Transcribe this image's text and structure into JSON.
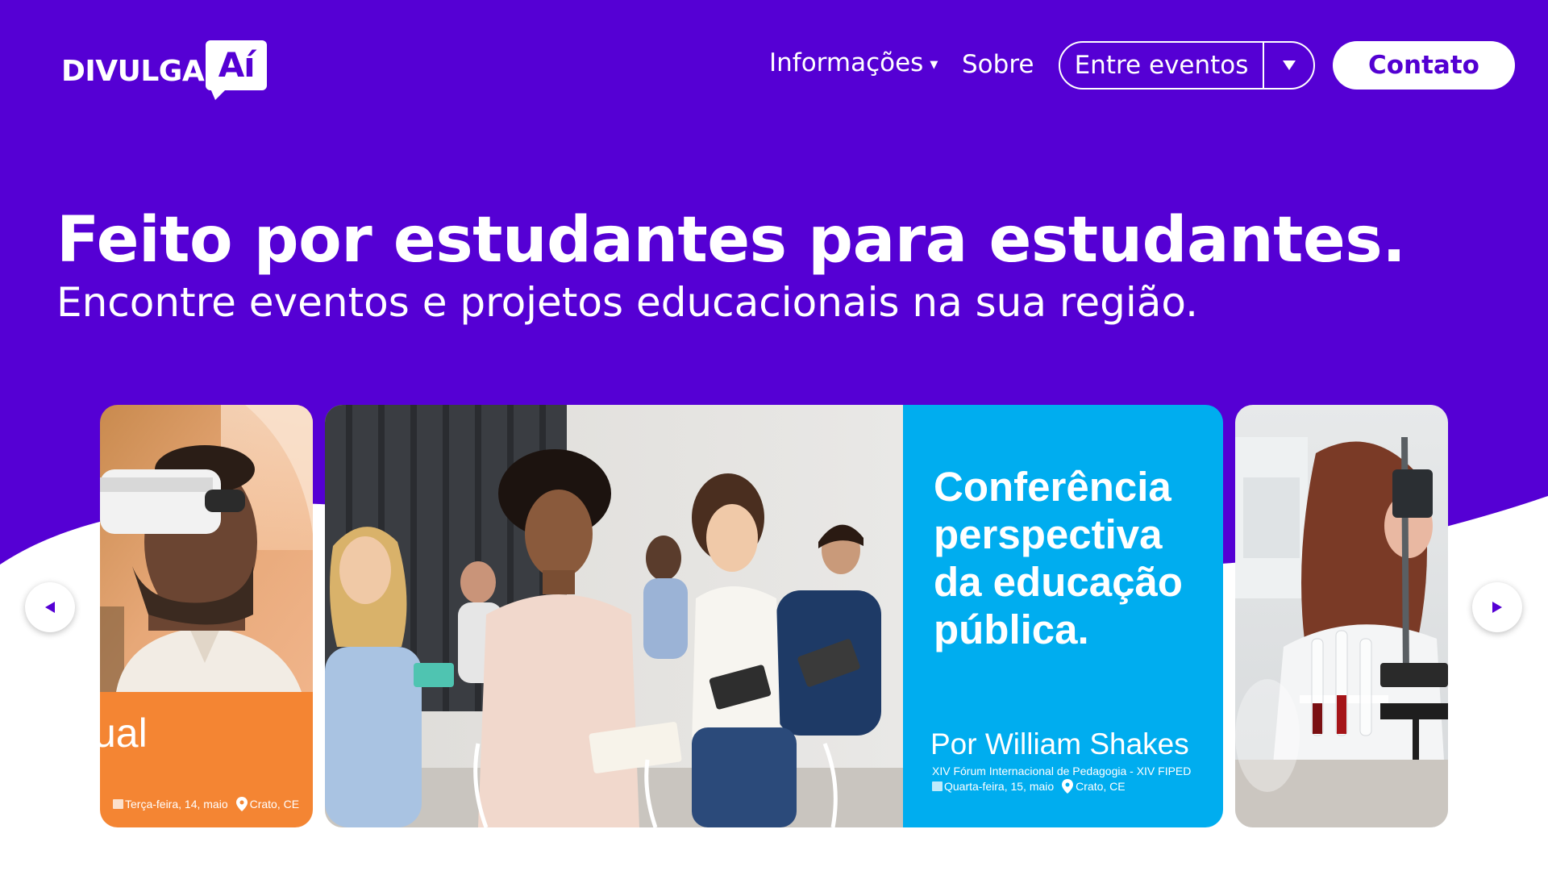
{
  "brand": {
    "name": "DIVULGA",
    "badge": "Aí",
    "primary_color": "#5500d4",
    "accent_color": "#ffffff"
  },
  "nav": {
    "info_label": "Informações",
    "about_label": "Sobre",
    "events_label": "Entre eventos",
    "contact_label": "Contato"
  },
  "hero": {
    "title": "Feito por estudantes para estudantes.",
    "subtitle": "Encontre eventos e projetos educacionais na sua região."
  },
  "carousel": {
    "prev_icon": "chevron-left-icon",
    "next_icon": "chevron-right-icon",
    "cards": [
      {
        "title_fragment": "ual",
        "date": "Terça-feira, 14, maio",
        "location": "Crato, CE",
        "panel_color": "#f48533",
        "image": "man-wearing-vr-headset"
      },
      {
        "title": "Conferência perspectiva da educação pública.",
        "author": "Por William Shakes",
        "event": "XIV Fórum Internacional de Pedagogia - XIV FIPED",
        "date": "Quarta-feira, 15, maio",
        "location": "Crato, CE",
        "panel_color": "#00adef",
        "image": "students-in-conference-audience"
      },
      {
        "image": "woman-at-microscope-in-lab"
      }
    ]
  }
}
